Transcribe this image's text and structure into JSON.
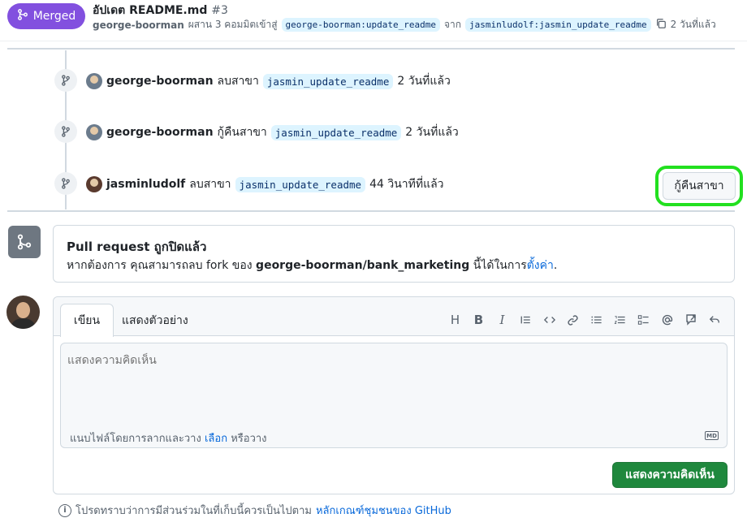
{
  "header": {
    "badge_label": "Merged",
    "title": "อัปเดต README.md",
    "number": "#3",
    "author": "george-boorman",
    "merge_text": "ผสาน 3 คอมมิตเข้าสู่",
    "base_branch": "george-boorman:update_readme",
    "from_word": "จาก",
    "head_branch": "jasminludolf:jasmin_update_readme",
    "time": "2 วันที่แล้ว"
  },
  "timeline": [
    {
      "user": "george-boorman",
      "action": "ลบสาขา",
      "branch": "jasmin_update_readme",
      "time": "2 วันที่แล้ว"
    },
    {
      "user": "george-boorman",
      "action": "กู้คืนสาขา",
      "branch": "jasmin_update_readme",
      "time": "2 วันที่แล้ว"
    },
    {
      "user": "jasminludolf",
      "action": "ลบสาขา",
      "branch": "jasmin_update_readme",
      "time": "44 วินาทีที่แล้ว"
    }
  ],
  "restore_button": "กู้คืนสาขา",
  "closed": {
    "title": "Pull request ถูกปิดแล้ว",
    "text_prefix": "หากต้องการ คุณสามารถลบ fork ของ",
    "repo": "george-boorman/bank_marketing",
    "text_mid": "นี้ได้ในการ",
    "settings_link": "ตั้งค่า",
    "text_end": "."
  },
  "comment": {
    "tab_write": "เขียน",
    "tab_preview": "แสดงตัวอย่าง",
    "placeholder": "แสดงความคิดเห็น",
    "attach_prefix": "แนบไฟล์โดยการลากและวาง",
    "attach_link": "เลือก",
    "attach_suffix": "หรือวาง",
    "md_label": "MD",
    "submit": "แสดงความคิดเห็น"
  },
  "toolbar": {
    "heading": "H",
    "bold": "B",
    "italic": "I"
  },
  "footer": {
    "prefix": "โปรดทราบว่าการมีส่วนร่วมในที่เก็บนี้ควรเป็นไปตาม",
    "link": "หลักเกณฑ์ชุมชนของ GitHub"
  }
}
